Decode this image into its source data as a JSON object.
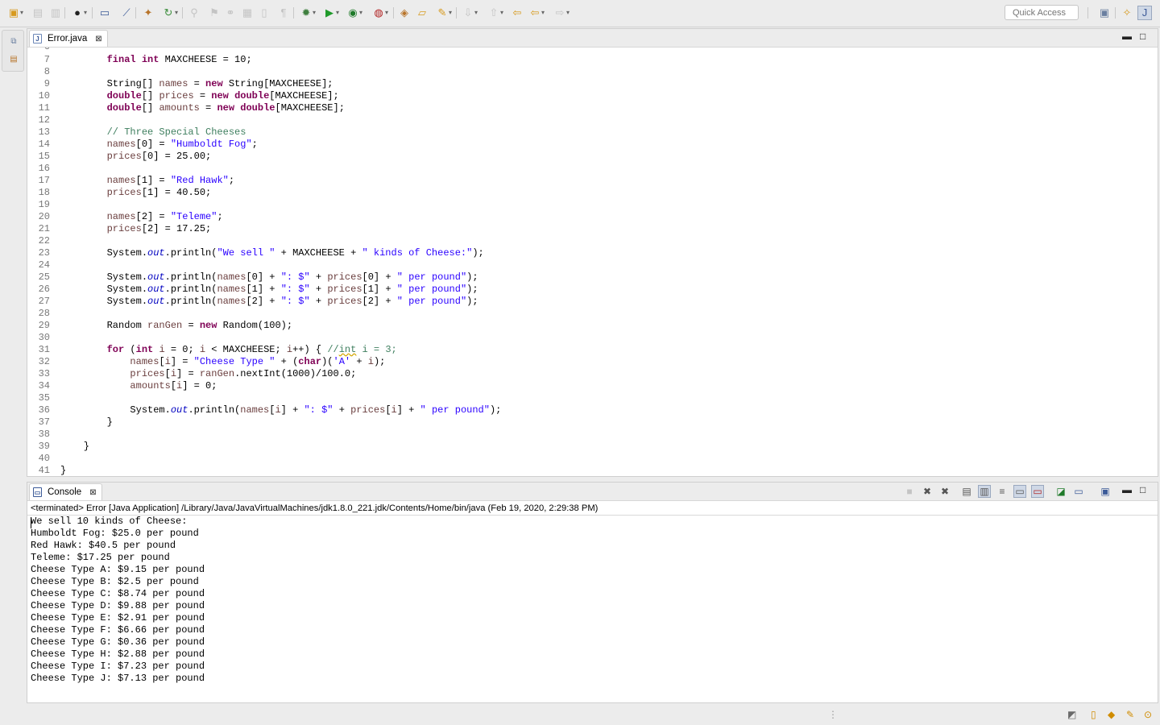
{
  "toolbar": {
    "quick_access_placeholder": "Quick Access"
  },
  "icons": {
    "new": "new-wizard-icon",
    "save": "save-icon",
    "debug": "debug-icon",
    "run": "run-icon",
    "back": "back-arrow-icon",
    "forward": "forward-arrow-icon"
  },
  "editor": {
    "tab_label": "Error.java",
    "lines": [
      {
        "n": "7",
        "t": "        final int MAXCHEESE = 10;"
      },
      {
        "n": "8",
        "t": ""
      },
      {
        "n": "9",
        "t": "        String[] names = new String[MAXCHEESE];"
      },
      {
        "n": "10",
        "t": "        double[] prices = new double[MAXCHEESE];"
      },
      {
        "n": "11",
        "t": "        double[] amounts = new double[MAXCHEESE];"
      },
      {
        "n": "12",
        "t": ""
      },
      {
        "n": "13",
        "t": "        // Three Special Cheeses"
      },
      {
        "n": "14",
        "t": "        names[0] = \"Humboldt Fog\";"
      },
      {
        "n": "15",
        "t": "        prices[0] = 25.00;"
      },
      {
        "n": "16",
        "t": ""
      },
      {
        "n": "17",
        "t": "        names[1] = \"Red Hawk\";"
      },
      {
        "n": "18",
        "t": "        prices[1] = 40.50;"
      },
      {
        "n": "19",
        "t": ""
      },
      {
        "n": "20",
        "t": "        names[2] = \"Teleme\";"
      },
      {
        "n": "21",
        "t": "        prices[2] = 17.25;"
      },
      {
        "n": "22",
        "t": ""
      },
      {
        "n": "23",
        "t": "        System.out.println(\"We sell \" + MAXCHEESE + \" kinds of Cheese:\");"
      },
      {
        "n": "24",
        "t": ""
      },
      {
        "n": "25",
        "t": "        System.out.println(names[0] + \": $\" + prices[0] + \" per pound\");"
      },
      {
        "n": "26",
        "t": "        System.out.println(names[1] + \": $\" + prices[1] + \" per pound\");"
      },
      {
        "n": "27",
        "t": "        System.out.println(names[2] + \": $\" + prices[2] + \" per pound\");"
      },
      {
        "n": "28",
        "t": ""
      },
      {
        "n": "29",
        "t": "        Random ranGen = new Random(100);"
      },
      {
        "n": "30",
        "t": ""
      },
      {
        "n": "31",
        "t": "        for (int i = 0; i < MAXCHEESE; i++) { //int i = 3;"
      },
      {
        "n": "32",
        "t": "            names[i] = \"Cheese Type \" + (char)('A' + i);"
      },
      {
        "n": "33",
        "t": "            prices[i] = ranGen.nextInt(1000)/100.0;"
      },
      {
        "n": "34",
        "t": "            amounts[i] = 0;"
      },
      {
        "n": "35",
        "t": ""
      },
      {
        "n": "36",
        "t": "            System.out.println(names[i] + \": $\" + prices[i] + \" per pound\");"
      },
      {
        "n": "37",
        "t": "        }"
      },
      {
        "n": "38",
        "t": ""
      },
      {
        "n": "39",
        "t": "    }"
      },
      {
        "n": "40",
        "t": ""
      },
      {
        "n": "41",
        "t": "}"
      }
    ]
  },
  "console": {
    "tab_label": "Console",
    "status": "<terminated> Error [Java Application] /Library/Java/JavaVirtualMachines/jdk1.8.0_221.jdk/Contents/Home/bin/java (Feb 19, 2020, 2:29:38 PM)",
    "output": [
      "We sell 10 kinds of Cheese:",
      "Humboldt Fog: $25.0 per pound",
      "Red Hawk: $40.5 per pound",
      "Teleme: $17.25 per pound",
      "Cheese Type A: $9.15 per pound",
      "Cheese Type B: $2.5 per pound",
      "Cheese Type C: $8.74 per pound",
      "Cheese Type D: $9.88 per pound",
      "Cheese Type E: $2.91 per pound",
      "Cheese Type F: $6.66 per pound",
      "Cheese Type G: $0.36 per pound",
      "Cheese Type H: $2.88 per pound",
      "Cheese Type I: $7.23 per pound",
      "Cheese Type J: $7.13 per pound"
    ]
  }
}
